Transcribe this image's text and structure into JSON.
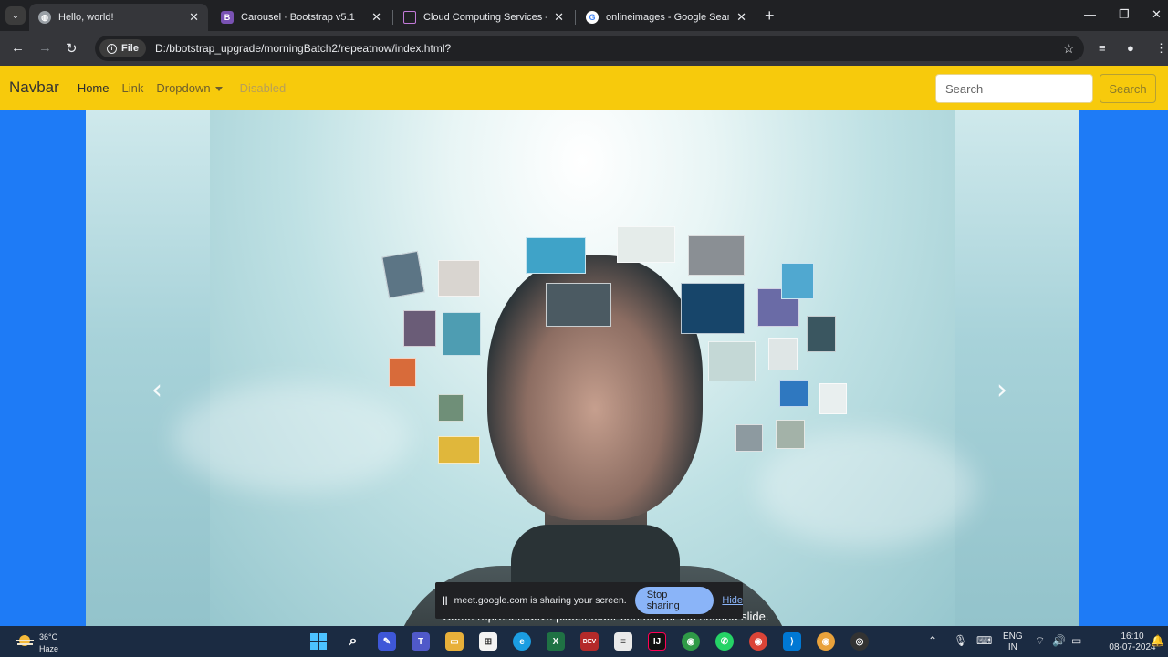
{
  "browser": {
    "tabs": [
      {
        "title": "Hello, world!",
        "icon": "globe-icon",
        "active": true
      },
      {
        "title": "Carousel · Bootstrap v5.1",
        "icon": "bootstrap-icon",
        "active": false
      },
      {
        "title": "Cloud Computing Services - Am",
        "icon": "aws-cube-icon",
        "active": false
      },
      {
        "title": "onlineimages - Google Search",
        "icon": "google-icon",
        "active": false
      }
    ],
    "file_chip": "File",
    "url": "D:/bbotstrap_upgrade/morningBatch2/repeatnow/index.html?"
  },
  "page": {
    "navbar": {
      "brand": "Navbar",
      "links": [
        "Home",
        "Link",
        "Dropdown",
        "Disabled"
      ],
      "search_placeholder": "Search",
      "search_button": "Search"
    },
    "carousel": {
      "caption": "Some representative placeholder content for the second slide.",
      "prev_glyph": "‹",
      "next_glyph": "›"
    }
  },
  "screen_share": {
    "message": "meet.google.com is sharing your screen.",
    "stop_label": "Stop sharing",
    "hide_label": "Hide"
  },
  "taskbar": {
    "weather_temp": "36°C",
    "weather_desc": "Haze",
    "lang_line1": "ENG",
    "lang_line2": "IN",
    "time": "16:10",
    "date": "08-07-2024"
  },
  "colors": {
    "navbar_bg": "#f7ca0c",
    "page_bg": "#1e7bf6",
    "share_button": "#8ab4f8"
  }
}
